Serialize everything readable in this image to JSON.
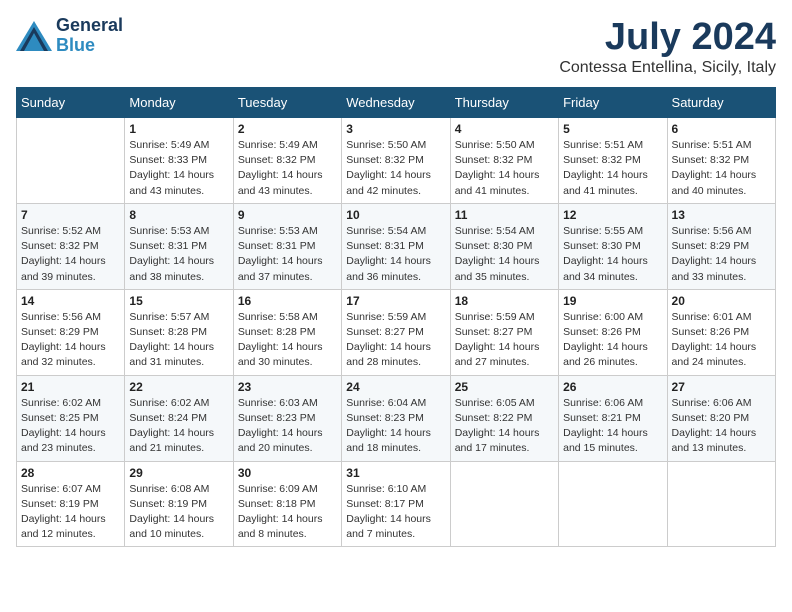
{
  "header": {
    "logo_line1": "General",
    "logo_line2": "Blue",
    "title": "July 2024",
    "subtitle": "Contessa Entellina, Sicily, Italy"
  },
  "weekdays": [
    "Sunday",
    "Monday",
    "Tuesday",
    "Wednesday",
    "Thursday",
    "Friday",
    "Saturday"
  ],
  "weeks": [
    [
      {
        "day": "",
        "info": ""
      },
      {
        "day": "1",
        "info": "Sunrise: 5:49 AM\nSunset: 8:33 PM\nDaylight: 14 hours\nand 43 minutes."
      },
      {
        "day": "2",
        "info": "Sunrise: 5:49 AM\nSunset: 8:32 PM\nDaylight: 14 hours\nand 43 minutes."
      },
      {
        "day": "3",
        "info": "Sunrise: 5:50 AM\nSunset: 8:32 PM\nDaylight: 14 hours\nand 42 minutes."
      },
      {
        "day": "4",
        "info": "Sunrise: 5:50 AM\nSunset: 8:32 PM\nDaylight: 14 hours\nand 41 minutes."
      },
      {
        "day": "5",
        "info": "Sunrise: 5:51 AM\nSunset: 8:32 PM\nDaylight: 14 hours\nand 41 minutes."
      },
      {
        "day": "6",
        "info": "Sunrise: 5:51 AM\nSunset: 8:32 PM\nDaylight: 14 hours\nand 40 minutes."
      }
    ],
    [
      {
        "day": "7",
        "info": "Sunrise: 5:52 AM\nSunset: 8:32 PM\nDaylight: 14 hours\nand 39 minutes."
      },
      {
        "day": "8",
        "info": "Sunrise: 5:53 AM\nSunset: 8:31 PM\nDaylight: 14 hours\nand 38 minutes."
      },
      {
        "day": "9",
        "info": "Sunrise: 5:53 AM\nSunset: 8:31 PM\nDaylight: 14 hours\nand 37 minutes."
      },
      {
        "day": "10",
        "info": "Sunrise: 5:54 AM\nSunset: 8:31 PM\nDaylight: 14 hours\nand 36 minutes."
      },
      {
        "day": "11",
        "info": "Sunrise: 5:54 AM\nSunset: 8:30 PM\nDaylight: 14 hours\nand 35 minutes."
      },
      {
        "day": "12",
        "info": "Sunrise: 5:55 AM\nSunset: 8:30 PM\nDaylight: 14 hours\nand 34 minutes."
      },
      {
        "day": "13",
        "info": "Sunrise: 5:56 AM\nSunset: 8:29 PM\nDaylight: 14 hours\nand 33 minutes."
      }
    ],
    [
      {
        "day": "14",
        "info": "Sunrise: 5:56 AM\nSunset: 8:29 PM\nDaylight: 14 hours\nand 32 minutes."
      },
      {
        "day": "15",
        "info": "Sunrise: 5:57 AM\nSunset: 8:28 PM\nDaylight: 14 hours\nand 31 minutes."
      },
      {
        "day": "16",
        "info": "Sunrise: 5:58 AM\nSunset: 8:28 PM\nDaylight: 14 hours\nand 30 minutes."
      },
      {
        "day": "17",
        "info": "Sunrise: 5:59 AM\nSunset: 8:27 PM\nDaylight: 14 hours\nand 28 minutes."
      },
      {
        "day": "18",
        "info": "Sunrise: 5:59 AM\nSunset: 8:27 PM\nDaylight: 14 hours\nand 27 minutes."
      },
      {
        "day": "19",
        "info": "Sunrise: 6:00 AM\nSunset: 8:26 PM\nDaylight: 14 hours\nand 26 minutes."
      },
      {
        "day": "20",
        "info": "Sunrise: 6:01 AM\nSunset: 8:26 PM\nDaylight: 14 hours\nand 24 minutes."
      }
    ],
    [
      {
        "day": "21",
        "info": "Sunrise: 6:02 AM\nSunset: 8:25 PM\nDaylight: 14 hours\nand 23 minutes."
      },
      {
        "day": "22",
        "info": "Sunrise: 6:02 AM\nSunset: 8:24 PM\nDaylight: 14 hours\nand 21 minutes."
      },
      {
        "day": "23",
        "info": "Sunrise: 6:03 AM\nSunset: 8:23 PM\nDaylight: 14 hours\nand 20 minutes."
      },
      {
        "day": "24",
        "info": "Sunrise: 6:04 AM\nSunset: 8:23 PM\nDaylight: 14 hours\nand 18 minutes."
      },
      {
        "day": "25",
        "info": "Sunrise: 6:05 AM\nSunset: 8:22 PM\nDaylight: 14 hours\nand 17 minutes."
      },
      {
        "day": "26",
        "info": "Sunrise: 6:06 AM\nSunset: 8:21 PM\nDaylight: 14 hours\nand 15 minutes."
      },
      {
        "day": "27",
        "info": "Sunrise: 6:06 AM\nSunset: 8:20 PM\nDaylight: 14 hours\nand 13 minutes."
      }
    ],
    [
      {
        "day": "28",
        "info": "Sunrise: 6:07 AM\nSunset: 8:19 PM\nDaylight: 14 hours\nand 12 minutes."
      },
      {
        "day": "29",
        "info": "Sunrise: 6:08 AM\nSunset: 8:19 PM\nDaylight: 14 hours\nand 10 minutes."
      },
      {
        "day": "30",
        "info": "Sunrise: 6:09 AM\nSunset: 8:18 PM\nDaylight: 14 hours\nand 8 minutes."
      },
      {
        "day": "31",
        "info": "Sunrise: 6:10 AM\nSunset: 8:17 PM\nDaylight: 14 hours\nand 7 minutes."
      },
      {
        "day": "",
        "info": ""
      },
      {
        "day": "",
        "info": ""
      },
      {
        "day": "",
        "info": ""
      }
    ]
  ]
}
